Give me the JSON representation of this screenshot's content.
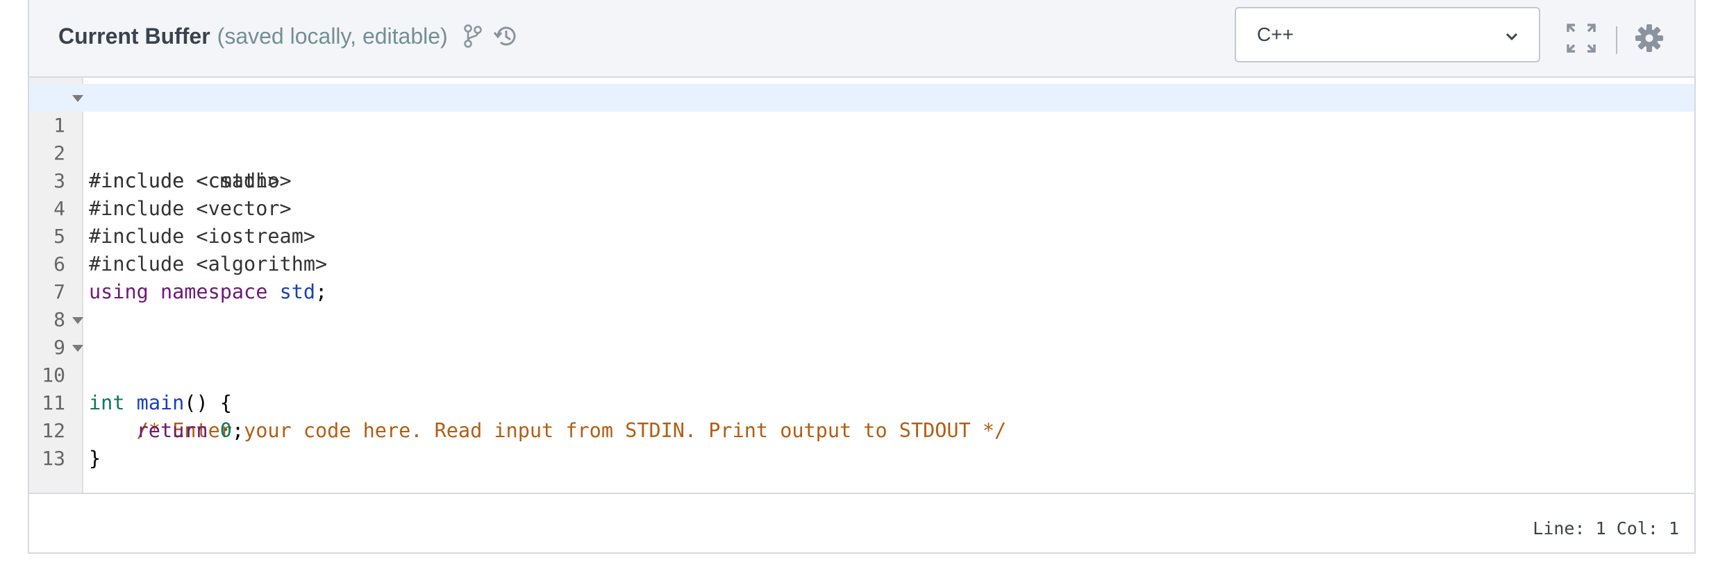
{
  "header": {
    "title": "Current Buffer",
    "subtitle": "(saved locally, editable)",
    "language_selected": "C++"
  },
  "editor": {
    "lines": [
      {
        "num": "1",
        "text": "#include <cmath>"
      },
      {
        "num": "2",
        "text": "#include <cstdio>"
      },
      {
        "num": "3",
        "text": "#include <vector>"
      },
      {
        "num": "4",
        "text": "#include <iostream>"
      },
      {
        "num": "5",
        "text": "#include <algorithm>"
      },
      {
        "num": "6",
        "kw": "using namespace",
        "ns": "std",
        "tail": ";"
      },
      {
        "num": "7"
      },
      {
        "num": "8"
      },
      {
        "num": "9",
        "type": "int",
        "fn": "main",
        "tail": "() {"
      },
      {
        "num": "10",
        "comment": "/* Enter your code here. Read input from STDIN. Print output to STDOUT */"
      },
      {
        "num": "11",
        "kw": "return",
        "val": "0",
        "tail": ";"
      },
      {
        "num": "12",
        "text": "}"
      },
      {
        "num": "13"
      }
    ]
  },
  "status": {
    "text": "Line: 1 Col: 1"
  },
  "colors": {
    "header_bg": "#f4f5f8",
    "active_line": "#e8f2fe",
    "keyword": "#6c1a77",
    "type": "#0b7b5a",
    "function": "#1a3fb8",
    "comment": "#b25e13"
  },
  "icons": [
    "branch-icon",
    "history-icon",
    "chevron-down-icon",
    "fullscreen-icon",
    "gear-icon"
  ]
}
